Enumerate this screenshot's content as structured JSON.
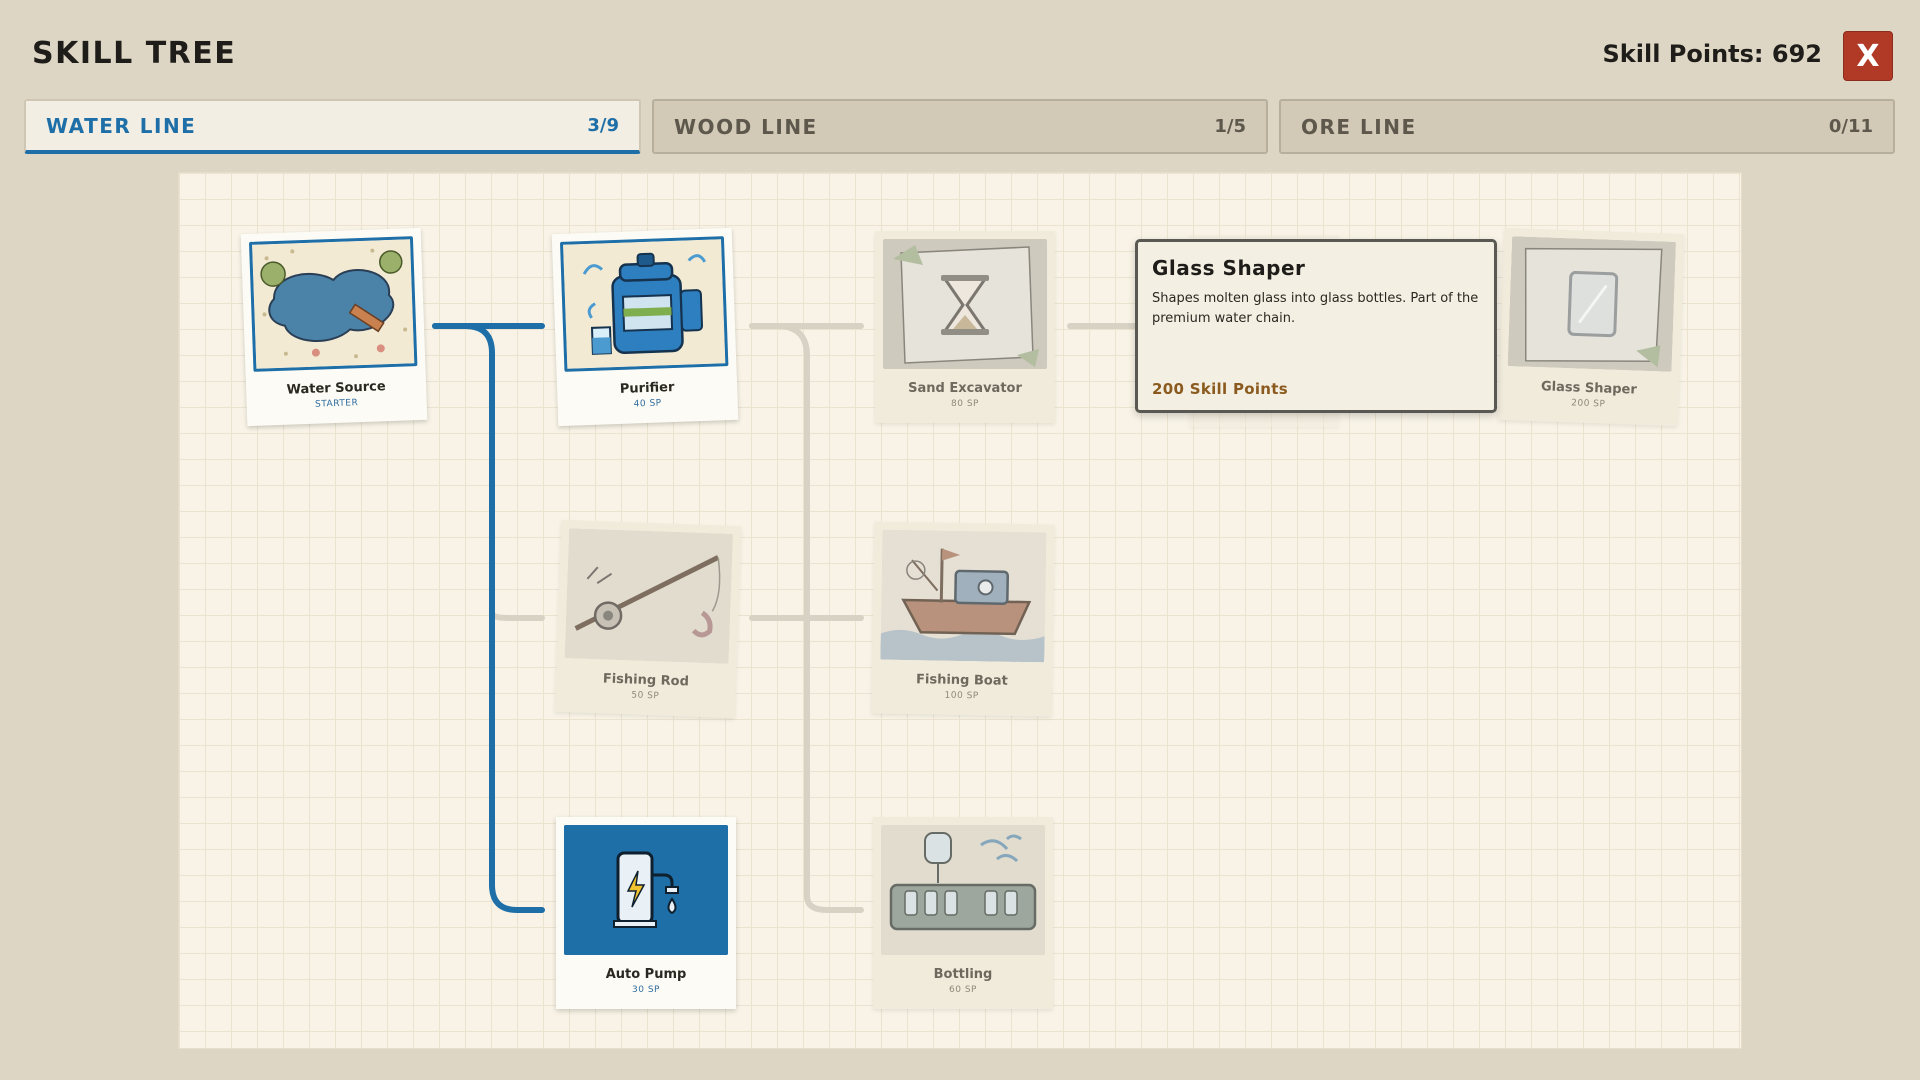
{
  "header": {
    "title": "SKILL TREE",
    "skill_points_label": "Skill Points:",
    "skill_points": "692",
    "close_label": "X"
  },
  "tabs": [
    {
      "label": "WATER LINE",
      "count": "3/9",
      "active": true
    },
    {
      "label": "WOOD LINE",
      "count": "1/5",
      "active": false
    },
    {
      "label": "ORE LINE",
      "count": "0/11",
      "active": false
    }
  ],
  "nodes": {
    "water_source": {
      "name": "Water Source",
      "cost": "STARTER",
      "unlocked": true,
      "icon": "pond-icon"
    },
    "purifier": {
      "name": "Purifier",
      "cost": "40 SP",
      "unlocked": true,
      "icon": "water-purifier-icon"
    },
    "sand_excavator": {
      "name": "Sand Excavator",
      "cost": "80 SP",
      "unlocked": false,
      "icon": "hourglass-icon"
    },
    "glass_shaper": {
      "name": "Glass Shaper",
      "cost": "200 SP",
      "unlocked": false,
      "icon": "glass-pane-icon"
    },
    "fishing_rod": {
      "name": "Fishing Rod",
      "cost": "50 SP",
      "unlocked": false,
      "icon": "fishing-rod-icon"
    },
    "fishing_boat": {
      "name": "Fishing Boat",
      "cost": "100 SP",
      "unlocked": false,
      "icon": "boat-icon"
    },
    "auto_pump": {
      "name": "Auto Pump",
      "cost": "30 SP",
      "unlocked": true,
      "icon": "pump-icon"
    },
    "bottling": {
      "name": "Bottling",
      "cost": "60 SP",
      "unlocked": false,
      "icon": "bottling-icon"
    }
  },
  "tooltip": {
    "title": "Glass Shaper",
    "description": "Shapes molten glass into glass bottles. Part of the premium water chain.",
    "cost": "200 Skill Points"
  },
  "colors": {
    "accent_blue": "#1e6fa8",
    "close_red": "#b13a26",
    "locked_line": "#d8d2c4",
    "cost_brown": "#8a5a1e"
  }
}
